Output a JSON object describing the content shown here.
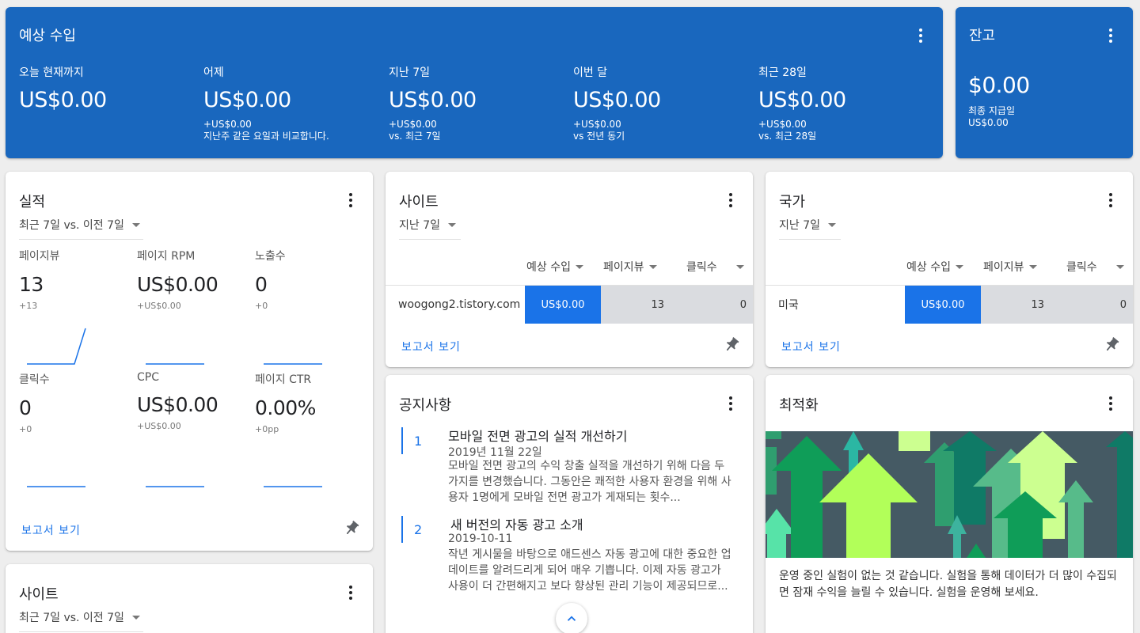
{
  "earnings": {
    "title": "예상 수입",
    "columns": [
      {
        "label": "오늘 현재까지",
        "value": "US$0.00",
        "delta": "",
        "compare": ""
      },
      {
        "label": "어제",
        "value": "US$0.00",
        "delta": "+US$0.00",
        "compare": "지난주 같은 요일과 비교합니다."
      },
      {
        "label": "지난 7일",
        "value": "US$0.00",
        "delta": "+US$0.00",
        "compare": "vs. 최근 7일"
      },
      {
        "label": "이번 달",
        "value": "US$0.00",
        "delta": "+US$0.00",
        "compare": "vs 전년 동기"
      },
      {
        "label": "최근 28일",
        "value": "US$0.00",
        "delta": "+US$0.00",
        "compare": "vs. 최근 28일"
      }
    ]
  },
  "balance": {
    "title": "잔고",
    "value": "$0.00",
    "last_payment_label": "최종 지급일",
    "last_payment_value": "US$0.00"
  },
  "performance": {
    "title": "실적",
    "range": "최근 7일 vs. 이전 7일",
    "metrics": [
      {
        "label": "페이지뷰",
        "value": "13",
        "delta": "+13"
      },
      {
        "label": "페이지 RPM",
        "value": "US$0.00",
        "delta": "+US$0.00"
      },
      {
        "label": "노출수",
        "value": "0",
        "delta": "+0"
      },
      {
        "label": "클릭수",
        "value": "0",
        "delta": "+0"
      },
      {
        "label": "CPC",
        "value": "US$0.00",
        "delta": "+US$0.00"
      },
      {
        "label": "페이지 CTR",
        "value": "0.00%",
        "delta": "+0pp"
      }
    ],
    "report_link": "보고서 보기",
    "colors": {
      "spark": "#1a73e8"
    }
  },
  "sites_card": {
    "title": "사이트",
    "range": "지난 7일",
    "columns": [
      "예상 수입",
      "페이지뷰",
      "클릭수"
    ],
    "rows": [
      {
        "name": "woogong2.tistory.com",
        "earnings": "US$0.00",
        "pageviews": "13",
        "clicks": "0"
      }
    ],
    "report_link": "보고서 보기"
  },
  "countries_card": {
    "title": "국가",
    "range": "지난 7일",
    "columns": [
      "예상 수입",
      "페이지뷰",
      "클릭수"
    ],
    "rows": [
      {
        "name": "미국",
        "earnings": "US$0.00",
        "pageviews": "13",
        "clicks": "0"
      }
    ],
    "report_link": "보고서 보기"
  },
  "notices": {
    "title": "공지사항",
    "items": [
      {
        "num": "1",
        "title": "모바일 전면 광고의 실적 개선하기",
        "date": "2019년 11월 22일",
        "body": "모바일 전면 광고의 수익 창출 실적을 개선하기 위해 다음 두 가지를 변경했습니다. 그동안은 쾌적한 사용자 환경을 위해 사용자 1명에게 모바일 전면 광고가 게재되는 횟수..."
      },
      {
        "num": "2",
        "title": "새 버전의 자동 광고 소개",
        "date": "2019-10-11",
        "body": "작년 게시물을 바탕으로 애드센스 자동 광고에 대한 중요한 업데이트를 알려드리게 되어 매우 기쁩니다. 이제 자동 광고가 사용이 더 간편해지고 보다 향상된 관리 기능이 제공되므로..."
      }
    ]
  },
  "optimization": {
    "title": "최적화",
    "body": "운영 중인 실험이 없는 것 같습니다. 실험을 통해 데이터가 더 많이 수집되면 잠재 수익을 늘릴 수 있습니다. 실험을 운영해 보세요."
  },
  "sites_bottom": {
    "title": "사이트",
    "range": "최근 7일 vs. 이전 7일"
  },
  "theme": {
    "blue": "#1967be",
    "accent": "#1a73e8",
    "bar_blue": "#1a73e8",
    "bar_grey": "#dadce0"
  }
}
